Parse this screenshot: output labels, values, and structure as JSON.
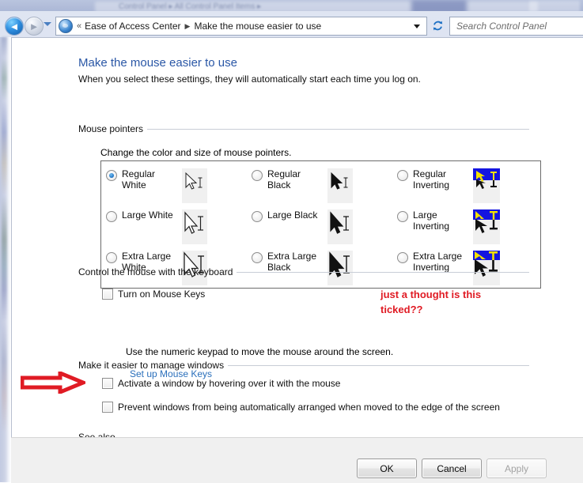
{
  "background_window": {
    "breadcrumb_text": "Control Panel  ▸  All Control Panel Items  ▸"
  },
  "nav": {
    "back_icon": "back-arrow-icon",
    "forward_icon": "forward-arrow-icon",
    "recent_icon": "chevron-down-icon",
    "address_icon": "control-panel-icon",
    "overflow_glyph": "«",
    "crumb_1": "Ease of Access Center",
    "crumb_sep": "▶",
    "crumb_2": "Make the mouse easier to use",
    "dropdown_icon": "chevron-down-icon",
    "refresh_icon": "refresh-icon",
    "refresh_glyph": "↻"
  },
  "search": {
    "placeholder": "Search Control Panel",
    "value": ""
  },
  "page": {
    "heading": "Make the mouse easier to use",
    "subheading": "When you select these settings, they will automatically start each time you log on."
  },
  "pointers_group": {
    "title": "Mouse pointers",
    "caption": "Change the color and size of mouse pointers.",
    "options": [
      {
        "label": "Regular White",
        "checked": true,
        "style": "white"
      },
      {
        "label": "Large White",
        "checked": false,
        "style": "white"
      },
      {
        "label": "Extra Large White",
        "checked": false,
        "style": "white"
      },
      {
        "label": "Regular Black",
        "checked": false,
        "style": "black"
      },
      {
        "label": "Large Black",
        "checked": false,
        "style": "black"
      },
      {
        "label": "Extra Large Black",
        "checked": false,
        "style": "black"
      },
      {
        "label": "Regular Inverting",
        "checked": false,
        "style": "inverting"
      },
      {
        "label": "Large Inverting",
        "checked": false,
        "style": "inverting"
      },
      {
        "label": "Extra Large Inverting",
        "checked": false,
        "style": "inverting"
      }
    ]
  },
  "mouse_keys_group": {
    "title": "Control the mouse with the keyboard",
    "checkbox_label": "Turn on Mouse Keys",
    "checkbox_checked": false,
    "description": "Use the numeric keypad to move the mouse around the screen.",
    "link_label": "Set up Mouse Keys"
  },
  "manage_windows_group": {
    "title": "Make it easier to manage windows",
    "activate_label": "Activate a window by hovering over it with the mouse",
    "activate_checked": false,
    "prevent_label": "Prevent windows from being automatically arranged when moved to the edge of the screen",
    "prevent_checked": false
  },
  "see_also_group": {
    "title": "See also"
  },
  "annotations": {
    "note_line_1": "just a thought is this",
    "note_line_2": "ticked??",
    "note_color": "#e01b24",
    "arrow_icon": "red-arrow-right-icon"
  },
  "footer": {
    "ok_label": "OK",
    "cancel_label": "Cancel",
    "apply_label": "Apply",
    "apply_disabled": true
  },
  "colors": {
    "heading_blue": "#2a57a6",
    "link_blue": "#2a6fbb",
    "annotation_red": "#e01b24",
    "selected_radio": "#1a6fc0"
  }
}
